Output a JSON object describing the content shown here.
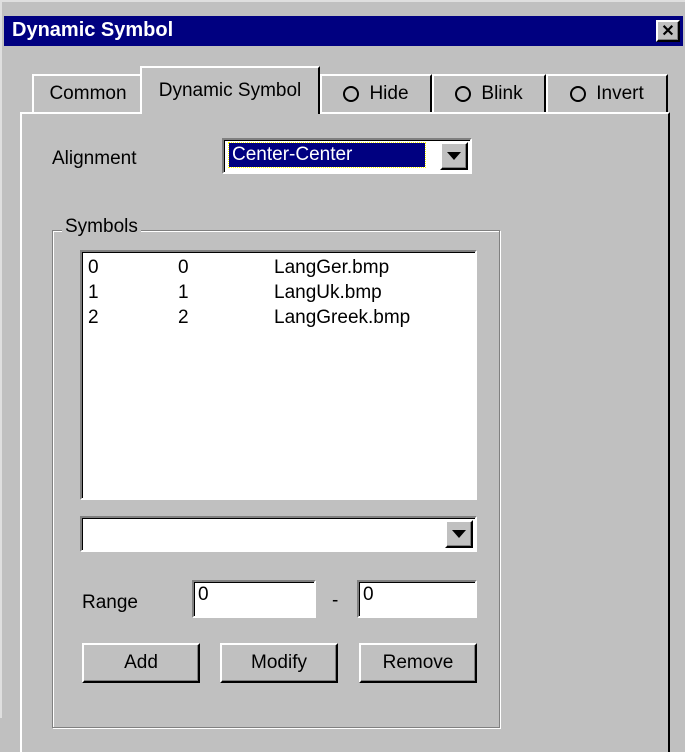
{
  "window": {
    "title": "Dynamic Symbol",
    "close_glyph": "✕"
  },
  "tabs": [
    {
      "label": "Common",
      "radio": false,
      "active": false
    },
    {
      "label": "Dynamic Symbol",
      "radio": false,
      "active": true
    },
    {
      "label": "Hide",
      "radio": true,
      "active": false
    },
    {
      "label": "Blink",
      "radio": true,
      "active": false
    },
    {
      "label": "Invert",
      "radio": true,
      "active": false
    }
  ],
  "alignment": {
    "label": "Alignment",
    "value": "Center-Center"
  },
  "symbols": {
    "group_label": "Symbols",
    "rows": [
      {
        "col1": "0",
        "col2": "0",
        "file": "LangGer.bmp"
      },
      {
        "col1": "1",
        "col2": "1",
        "file": "LangUk.bmp"
      },
      {
        "col1": "2",
        "col2": "2",
        "file": "LangGreek.bmp"
      }
    ],
    "dropdown_value": ""
  },
  "range": {
    "label": "Range",
    "from": "0",
    "separator": "-",
    "to": "0"
  },
  "buttons": {
    "add": "Add",
    "modify": "Modify",
    "remove": "Remove"
  },
  "colors": {
    "titlebar": "#000080",
    "face": "#c0c0c0",
    "selection": "#000080"
  }
}
